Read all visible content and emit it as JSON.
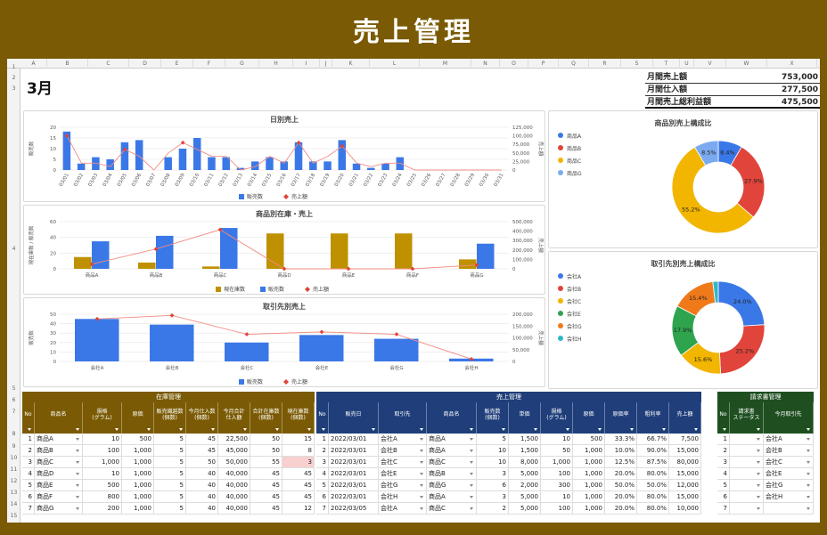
{
  "banner": {
    "title": "売上管理"
  },
  "sheet": {
    "columns": [
      "A",
      "B",
      "C",
      "D",
      "E",
      "F",
      "G",
      "H",
      "I",
      "J",
      "K",
      "L",
      "M",
      "N",
      "O",
      "P",
      "Q",
      "R",
      "S",
      "T",
      "U",
      "V",
      "W",
      "X",
      "Y"
    ],
    "rows": [
      "1",
      "2",
      "3",
      "4",
      "5",
      "6",
      "7",
      "8",
      "9",
      "10",
      "11",
      "12",
      "13",
      "14",
      "15"
    ],
    "month": "3月"
  },
  "summary": [
    {
      "label": "月間売上額",
      "value": "753,000"
    },
    {
      "label": "月間仕入額",
      "value": "277,500"
    },
    {
      "label": "月間売上総利益額",
      "value": "475,500"
    }
  ],
  "charts": {
    "daily": {
      "title": "日別売上",
      "ylabel_left": "販売数",
      "ylabel_right": "売上額",
      "left_ticks": [
        "20",
        "15",
        "10",
        "5",
        "0"
      ],
      "right_ticks": [
        "125,000",
        "100,000",
        "75,000",
        "50,000",
        "25,000",
        "0"
      ],
      "legend": [
        "販売数",
        "売上額"
      ]
    },
    "product": {
      "title": "商品別在庫・売上",
      "ylabel_left": "現在庫数 / 販売数",
      "ylabel_right": "売上額",
      "left_ticks": [
        "60",
        "40",
        "20",
        "0"
      ],
      "right_ticks": [
        "500,000",
        "400,000",
        "300,000",
        "200,000",
        "100,000",
        "0"
      ],
      "legend": [
        "現在庫数",
        "販売数",
        "売上額"
      ]
    },
    "client": {
      "title": "取引先別売上",
      "ylabel_left": "販売数",
      "ylabel_right": "売上額",
      "left_ticks": [
        "50",
        "40",
        "30",
        "20",
        "10",
        "0"
      ],
      "right_ticks": [
        "200,000",
        "150,000",
        "100,000",
        "50,000",
        "0"
      ],
      "legend": [
        "販売数",
        "売上額"
      ]
    },
    "pie1": {
      "title": "商品別売上構成比",
      "legend": [
        "商品A",
        "商品B",
        "商品C",
        "商品G"
      ]
    },
    "pie2": {
      "title": "取引先別売上構成比",
      "legend": [
        "会社A",
        "会社B",
        "会社C",
        "会社E",
        "会社G",
        "会社H"
      ]
    }
  },
  "chart_data": [
    {
      "type": "bar",
      "title": "日別売上",
      "categories": [
        "03/01",
        "03/02",
        "03/03",
        "03/04",
        "03/05",
        "03/06",
        "03/07",
        "03/08",
        "03/09",
        "03/10",
        "03/11",
        "03/12",
        "03/13",
        "03/14",
        "03/15",
        "03/16",
        "03/17",
        "03/18",
        "03/19",
        "03/20",
        "03/21",
        "03/22",
        "03/23",
        "03/24",
        "03/25",
        "03/26",
        "03/27",
        "03/28",
        "03/29",
        "03/30",
        "03/31"
      ],
      "series": [
        {
          "name": "販売数",
          "type": "bar",
          "values": [
            18,
            3,
            6,
            5,
            13,
            14,
            0,
            6,
            10,
            15,
            6,
            6,
            1,
            4,
            6,
            4,
            13,
            4,
            4,
            14,
            3,
            1,
            3,
            6,
            0,
            0,
            0,
            0,
            0,
            0,
            0
          ]
        },
        {
          "name": "売上額",
          "type": "line",
          "values": [
            100000,
            20000,
            20000,
            10000,
            60000,
            40000,
            0,
            50000,
            80000,
            60000,
            40000,
            40000,
            0,
            10000,
            40000,
            20000,
            80000,
            20000,
            40000,
            70000,
            20000,
            10000,
            20000,
            20000,
            0,
            0,
            0,
            0,
            0,
            0,
            0
          ]
        }
      ],
      "ylim_left": [
        0,
        20
      ],
      "ylim_right": [
        0,
        125000
      ],
      "ylabel": "販売数",
      "ylabel2": "売上額"
    },
    {
      "type": "bar",
      "title": "商品別在庫・売上",
      "categories": [
        "商品A",
        "商品B",
        "商品C",
        "商品D",
        "商品E",
        "商品F",
        "商品G"
      ],
      "series": [
        {
          "name": "現在庫数",
          "type": "bar",
          "values": [
            15,
            8,
            3,
            45,
            45,
            45,
            12
          ]
        },
        {
          "name": "販売数",
          "type": "bar",
          "values": [
            35,
            42,
            52,
            0,
            0,
            0,
            32
          ]
        },
        {
          "name": "売上額",
          "type": "line",
          "values": [
            50000,
            210000,
            415000,
            0,
            0,
            0,
            40000
          ]
        }
      ],
      "ylim_left": [
        0,
        60
      ],
      "ylim_right": [
        0,
        500000
      ],
      "ylabel": "現在庫数 / 販売数",
      "ylabel2": "売上額"
    },
    {
      "type": "bar",
      "title": "取引先別売上",
      "categories": [
        "会社A",
        "会社B",
        "会社C",
        "会社E",
        "会社G",
        "会社H"
      ],
      "series": [
        {
          "name": "販売数",
          "type": "bar",
          "values": [
            45,
            39,
            20,
            28,
            24,
            3
          ]
        },
        {
          "name": "売上額",
          "type": "line",
          "values": [
            180000,
            195000,
            115000,
            125000,
            115000,
            10000
          ]
        }
      ],
      "ylim_left": [
        0,
        50
      ],
      "ylim_right": [
        0,
        200000
      ],
      "ylabel": "販売数",
      "ylabel2": "売上額"
    },
    {
      "type": "pie",
      "title": "商品別売上構成比",
      "labels": [
        "商品A",
        "商品B",
        "商品C",
        "商品G"
      ],
      "values": [
        8.4,
        27.9,
        55.2,
        8.5
      ],
      "colors": [
        "#3b78e7",
        "#e0443a",
        "#f2b500",
        "#7baaf0"
      ]
    },
    {
      "type": "pie",
      "title": "取引先別売上構成比",
      "labels": [
        "会社A",
        "会社B",
        "会社C",
        "会社E",
        "会社G",
        "会社H"
      ],
      "values": [
        24.0,
        25.2,
        15.6,
        17.9,
        15.4,
        1.9
      ],
      "colors": [
        "#3b78e7",
        "#e0443a",
        "#f2b500",
        "#2ea44f",
        "#f07a1a",
        "#30b8c8"
      ]
    }
  ],
  "tables": {
    "inventory": {
      "title": "在庫管理",
      "color": "#7a5a04",
      "headers": [
        "No",
        "商品名",
        "規格\n(グラム)",
        "原価",
        "販売繊越数\n(個数)",
        "今月仕入数\n(個数)",
        "今月合計\n仕入額",
        "合計在庫数\n(個数)",
        "現在庫数\n(個数)"
      ],
      "widths": [
        14,
        54,
        44,
        36,
        36,
        36,
        36,
        36,
        36
      ],
      "rows": [
        [
          "1",
          "商品A",
          "10",
          "500",
          "5",
          "45",
          "22,500",
          "50",
          "15"
        ],
        [
          "2",
          "商品B",
          "100",
          "1,000",
          "5",
          "45",
          "45,000",
          "50",
          "8"
        ],
        [
          "3",
          "商品C",
          "1,000",
          "1,000",
          "5",
          "50",
          "50,000",
          "55",
          "3"
        ],
        [
          "4",
          "商品D",
          "10",
          "1,000",
          "5",
          "40",
          "40,000",
          "45",
          "45"
        ],
        [
          "5",
          "商品E",
          "500",
          "1,000",
          "5",
          "40",
          "40,000",
          "45",
          "45"
        ],
        [
          "6",
          "商品F",
          "800",
          "1,000",
          "5",
          "40",
          "40,000",
          "45",
          "45"
        ],
        [
          "7",
          "商品G",
          "200",
          "1,000",
          "5",
          "40",
          "40,000",
          "45",
          "12"
        ]
      ]
    },
    "sales": {
      "title": "売上管理",
      "color": "#1f3e7a",
      "headers": [
        "No",
        "販売日",
        "取引先",
        "商品名",
        "販売数\n(個数)",
        "単価",
        "規格\n(グラム)",
        "原価",
        "原価率",
        "粗利率",
        "売上額"
      ],
      "widths": [
        14,
        56,
        54,
        56,
        36,
        36,
        36,
        36,
        36,
        36,
        36
      ],
      "rows": [
        [
          "1",
          "2022/03/01",
          "会社A",
          "商品A",
          "5",
          "1,500",
          "10",
          "500",
          "33.3%",
          "66.7%",
          "7,500"
        ],
        [
          "2",
          "2022/03/01",
          "会社B",
          "商品A",
          "10",
          "1,500",
          "50",
          "1,000",
          "10.0%",
          "90.0%",
          "15,000"
        ],
        [
          "3",
          "2022/03/01",
          "会社C",
          "商品C",
          "10",
          "8,000",
          "1,000",
          "1,000",
          "12.5%",
          "87.5%",
          "80,000"
        ],
        [
          "4",
          "2022/03/01",
          "会社E",
          "商品B",
          "3",
          "5,000",
          "100",
          "1,000",
          "20.0%",
          "80.0%",
          "15,000"
        ],
        [
          "5",
          "2022/03/01",
          "会社G",
          "商品G",
          "6",
          "2,000",
          "300",
          "1,000",
          "50.0%",
          "50.0%",
          "12,000"
        ],
        [
          "6",
          "2022/03/01",
          "会社H",
          "商品A",
          "3",
          "5,000",
          "10",
          "1,000",
          "20.0%",
          "80.0%",
          "15,000"
        ],
        [
          "7",
          "2022/03/05",
          "会社A",
          "商品C",
          "2",
          "5,000",
          "100",
          "1,000",
          "20.0%",
          "80.0%",
          "10,000"
        ]
      ]
    },
    "billing": {
      "title": "請求書管理",
      "color": "#1f4f21",
      "headers": [
        "No",
        "請求書\nステータス",
        "今月取引先"
      ],
      "widths": [
        14,
        38,
        56
      ],
      "rows": [
        [
          "1",
          "",
          "会社A"
        ],
        [
          "2",
          "",
          "会社B"
        ],
        [
          "3",
          "",
          "会社C"
        ],
        [
          "4",
          "",
          "会社E"
        ],
        [
          "5",
          "",
          "会社G"
        ],
        [
          "6",
          "",
          "会社H"
        ],
        [
          "7",
          "",
          ""
        ]
      ]
    }
  }
}
